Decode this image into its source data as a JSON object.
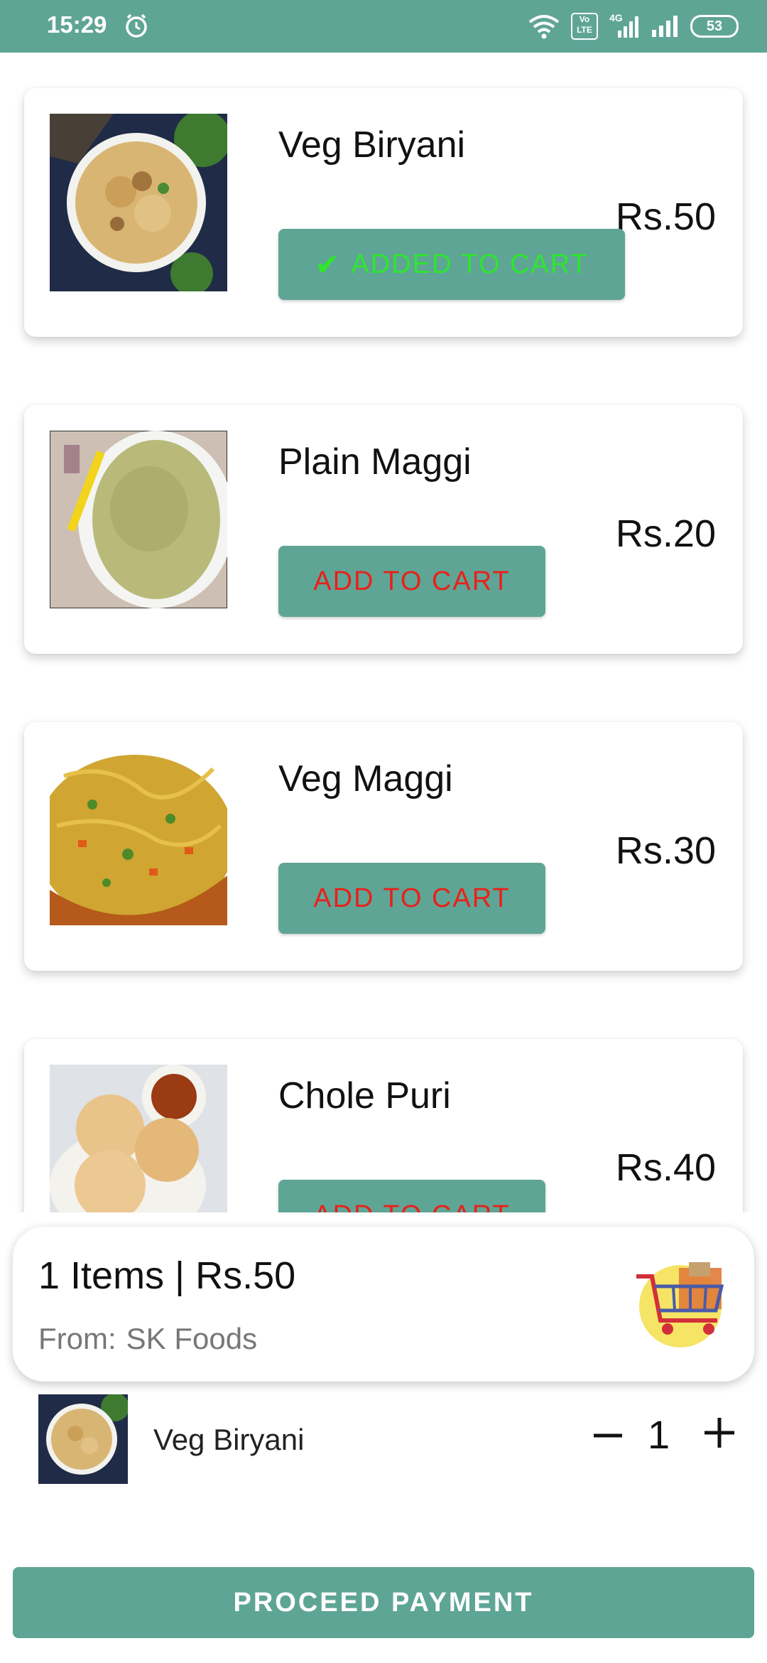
{
  "status_bar": {
    "time": "15:29",
    "battery": "53",
    "network_label_1": "Vo LTE",
    "network_label_2": "4G"
  },
  "menu": [
    {
      "name": "Veg Biryani",
      "price": "Rs.50",
      "button": "ADDED TO CART",
      "added": true
    },
    {
      "name": "Plain Maggi",
      "price": "Rs.20",
      "button": "ADD TO CART",
      "added": false
    },
    {
      "name": "Veg Maggi",
      "price": "Rs.30",
      "button": "ADD TO CART",
      "added": false
    },
    {
      "name": "Chole Puri",
      "price": "Rs.40",
      "button": "ADD TO CART",
      "added": false
    }
  ],
  "cart_summary": {
    "total": "1 Items | Rs.50",
    "from_label": "From:",
    "restaurant": "SK Foods"
  },
  "cart_items": [
    {
      "name": "Veg Biryani",
      "quantity": "1"
    }
  ],
  "proceed_label": "PROCEED PAYMENT",
  "colors": {
    "accent": "#5fa596",
    "add_text": "#e8211a",
    "added_text": "#2ee62e"
  },
  "icons": {
    "added_check": "check-icon",
    "minus": "minus-icon",
    "plus": "plus-icon",
    "cart": "shopping-cart-icon"
  }
}
